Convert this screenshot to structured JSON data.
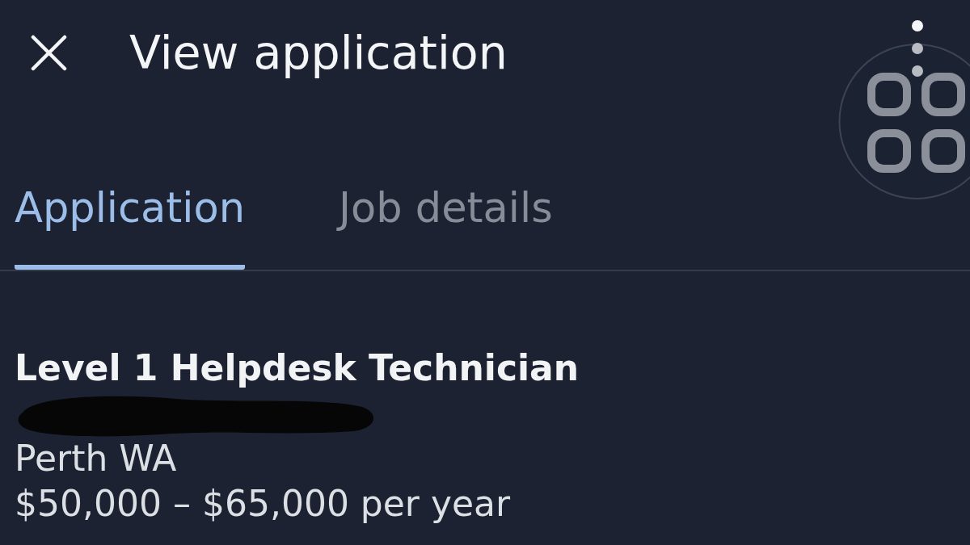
{
  "header": {
    "title": "View application"
  },
  "tabs": [
    {
      "label": "Application",
      "selected": true
    },
    {
      "label": "Job details",
      "selected": false
    }
  ],
  "job": {
    "title": "Level 1 Helpdesk Technician",
    "company": {
      "redacted": true
    },
    "location": "Perth WA",
    "salary": "$50,000 – $65,000 per year"
  }
}
